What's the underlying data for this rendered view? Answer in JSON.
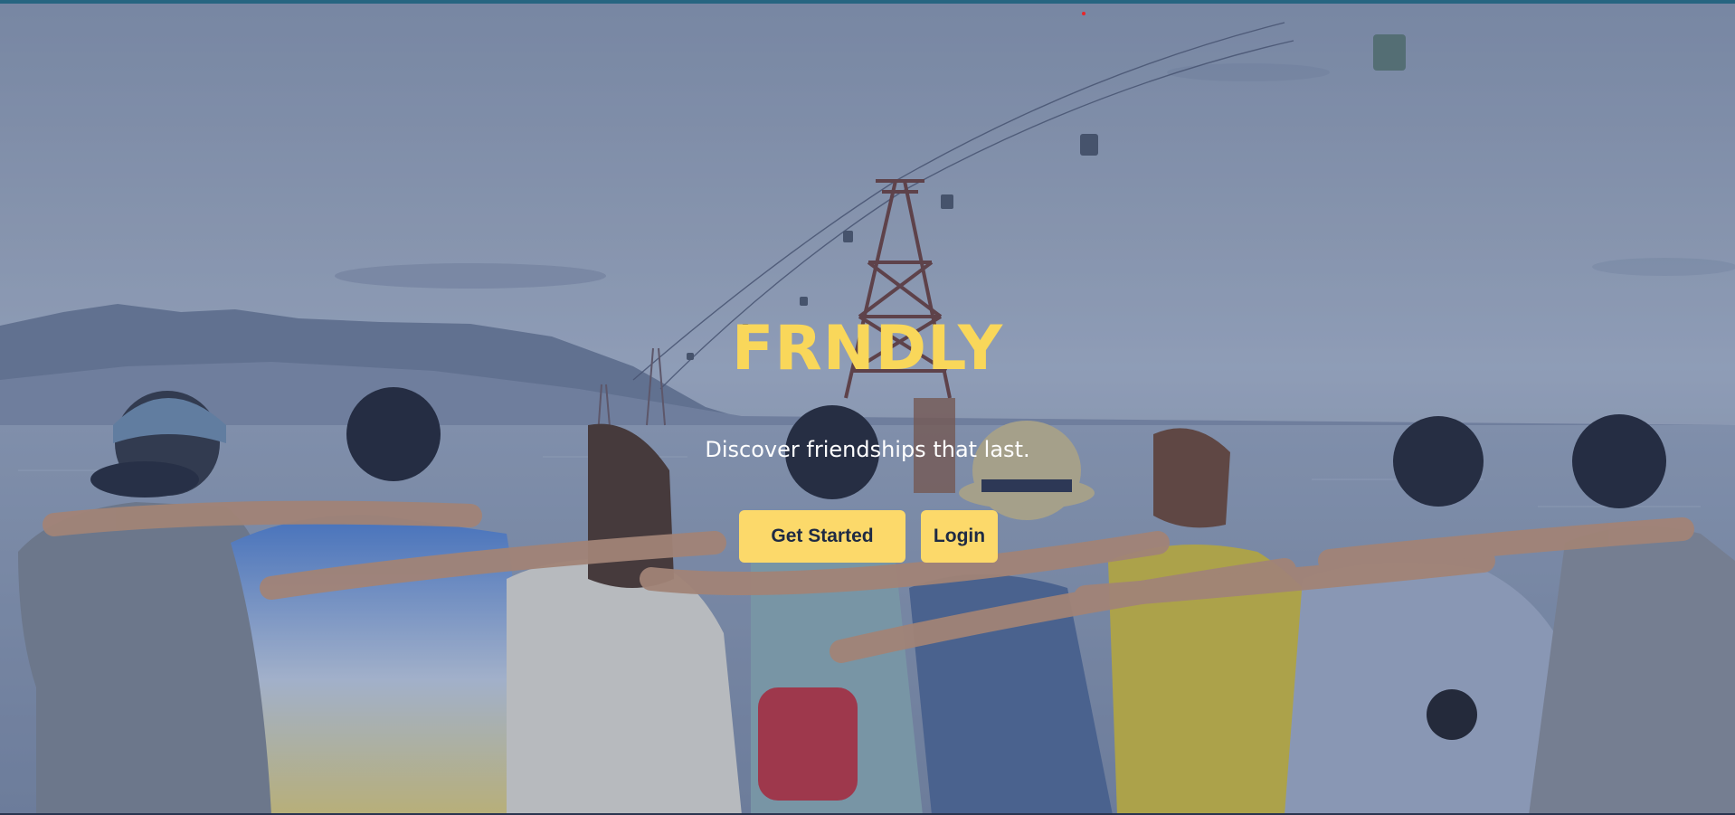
{
  "hero": {
    "brand": "FRNDLY",
    "tagline": "Discover friendships that last.",
    "image_description_icon": "group-of-friends-photo"
  },
  "actions": {
    "get_started_label": "Get Started",
    "login_label": "Login"
  },
  "colors": {
    "brand_yellow": "#f9d75a",
    "button_bg": "#fcd96a",
    "button_text": "#1e2a44",
    "top_strip": "#1f6e86",
    "tagline": "#ffffff"
  }
}
